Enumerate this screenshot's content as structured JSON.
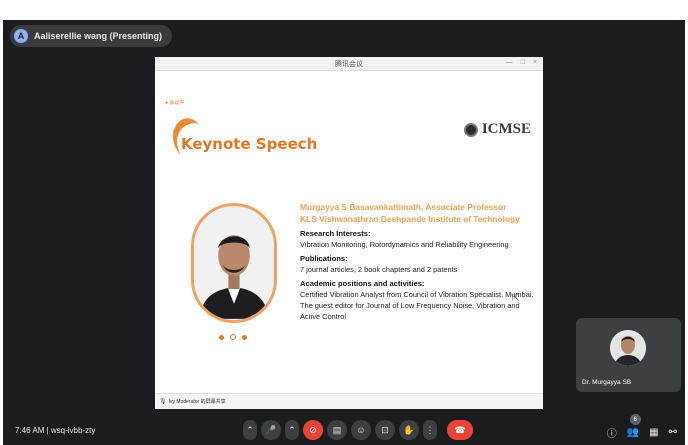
{
  "meet": {
    "presenter_initial": "A",
    "presenter_label": "Aaliserellie wang (Presenting)",
    "meeting_time_code": "7:46 AM  |  wsq-ivbb-zty"
  },
  "shared_window": {
    "title": "腾讯会议",
    "controls": [
      "—",
      "□",
      "×"
    ],
    "footer_icon": "mic-icon",
    "footer_text": "Ivy Moderator 的屏幕共享"
  },
  "slide": {
    "brand_small": "● 会议中",
    "title": "Keynote Speech",
    "logo_text": "ICMSE",
    "speaker_name": "Murgayya S Basavankattimath, Associate Professor",
    "speaker_affiliation": "KLS Vishwanathrao Deshpande Institute of Technology",
    "research_heading": "Research Interests:",
    "research_text": "Vibration Monitoring, Rotordynamics and Reliability Engineering",
    "pub_heading": "Publications:",
    "pub_text": "7 journal articles, 2 book chapters and 2 patents",
    "academic_heading": "Academic positions and activities:",
    "academic_text": "Certified Vibration Analyst from Council of Vibration Specialist, Mumbai. The guest editor for Journal of Low Frequency Noise, Vibration and Active Control",
    "carousel_active_index": 2,
    "accent_color": "#e07626"
  },
  "participant_tile": {
    "name": "Dr. Murgayya SB"
  },
  "controls": {
    "buttons": [
      "chevron-up-icon",
      "mic-icon",
      "chevron-up-icon",
      "camera-off-icon",
      "captions-icon",
      "emoji-icon",
      "present-icon",
      "raise-hand-icon",
      "more-icon",
      "hangup-icon"
    ],
    "participant_count": "6"
  },
  "colors": {
    "meet_background": "#1b1c1f",
    "control_background": "#3c4043",
    "danger": "#ea4335"
  }
}
